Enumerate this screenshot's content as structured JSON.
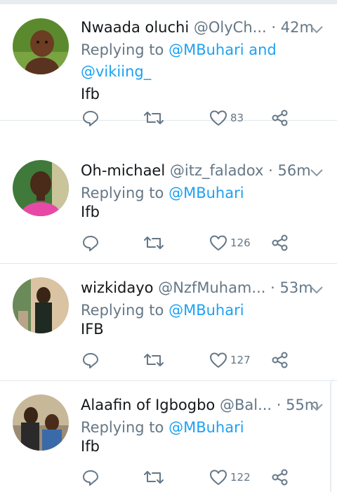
{
  "tweets": [
    {
      "name": "Nwaada oluchi",
      "handle": "@OlyCh...",
      "time": "42m",
      "replying_prefix": "Replying to ",
      "mention1": "@MBuhari",
      "mention_join": " and",
      "mention2": "@vikiing_",
      "body": "Ifb",
      "likes": "83"
    },
    {
      "name": "Oh-michael",
      "handle": "@itz_faladox",
      "time": "56m",
      "replying_prefix": "Replying to ",
      "mention1": "@MBuhari",
      "body": "Ifb",
      "likes": "126"
    },
    {
      "name": "wizkidayo",
      "handle": "@NzfMuham...",
      "time": "53m",
      "replying_prefix": "Replying to ",
      "mention1": "@MBuhari",
      "body": "IFB",
      "likes": "127"
    },
    {
      "name": "Alaafin of Igbogbo",
      "handle": "@Bal...",
      "time": "55m",
      "replying_prefix": "Replying to ",
      "mention1": "@MBuhari",
      "body": "Ifb",
      "likes": "122"
    }
  ],
  "dot": "·",
  "icons": [
    "reply-icon",
    "retweet-icon",
    "like-icon",
    "share-icon",
    "chevron-down-icon"
  ],
  "colors": {
    "accent": "#1da1f2",
    "muted": "#657786",
    "divider": "#e1e8ed"
  }
}
